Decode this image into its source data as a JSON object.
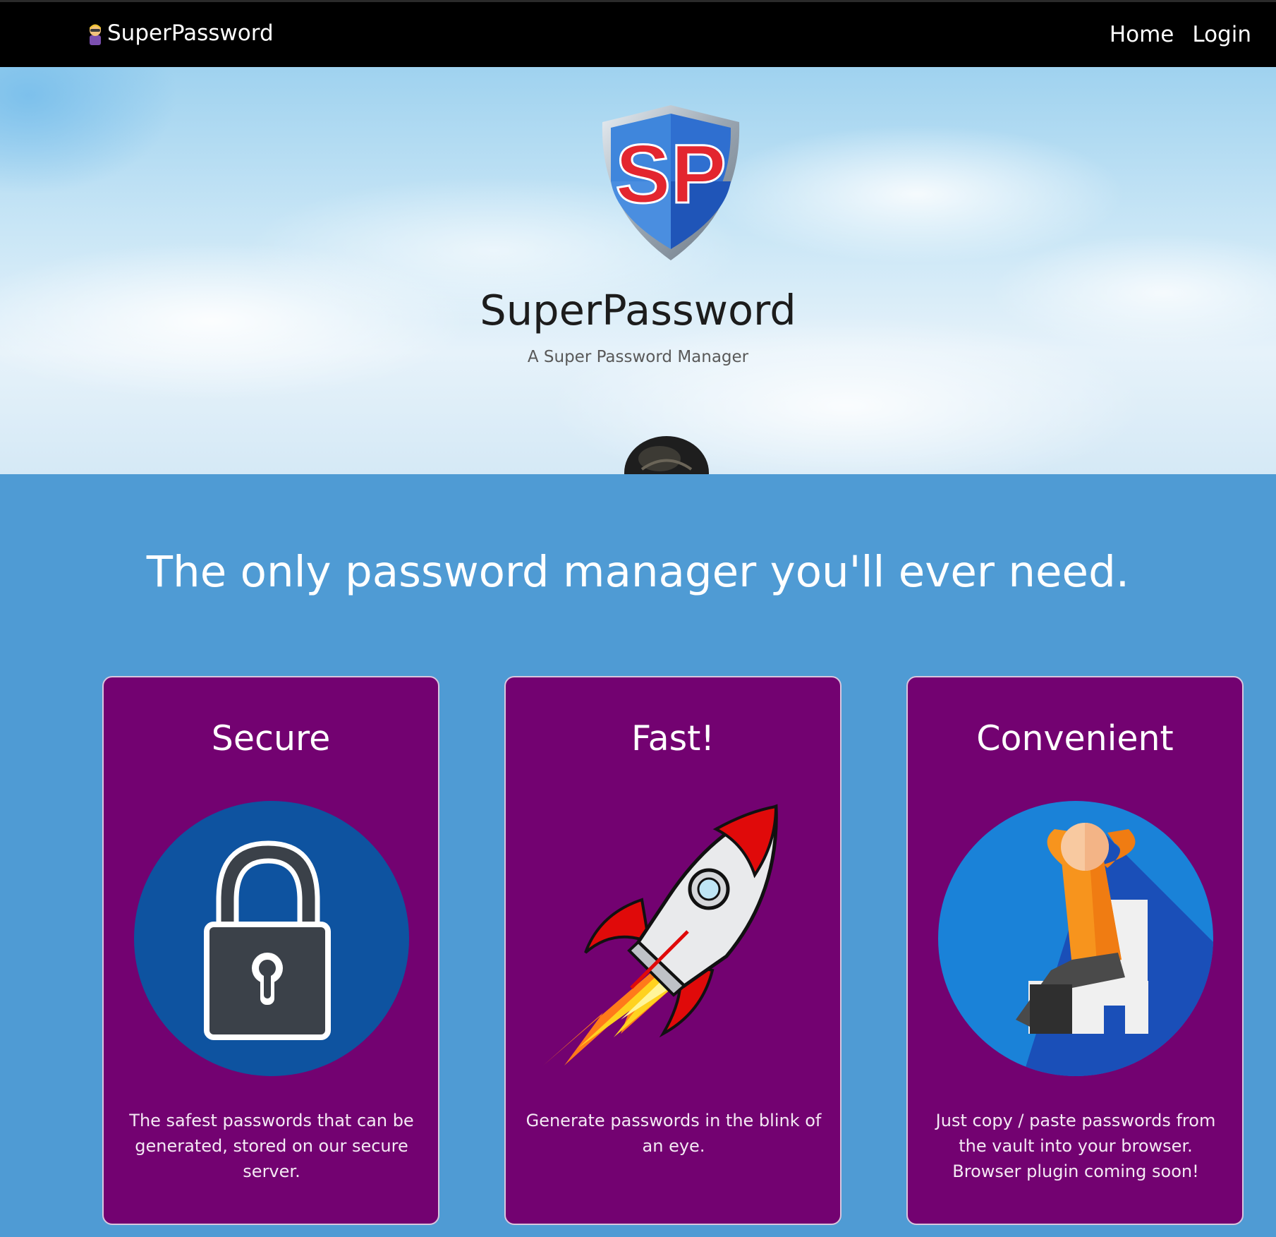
{
  "navbar": {
    "brand": "SuperPassword",
    "brand_icon": "superhero-icon",
    "links": [
      "Home",
      "Login"
    ]
  },
  "hero": {
    "logo_icon": "sp-shield-logo",
    "logo_text": "SP",
    "title": "SuperPassword",
    "subtitle": "A Super Password Manager"
  },
  "main": {
    "tagline": "The only password manager you'll ever need.",
    "cards": [
      {
        "title": "Secure",
        "icon": "padlock-icon",
        "text": "The safest passwords that can be generated, stored on our secure server."
      },
      {
        "title": "Fast!",
        "icon": "rocket-icon",
        "text": "Generate passwords in the blink of an eye."
      },
      {
        "title": "Convenient",
        "icon": "relaxing-person-icon",
        "text": "Just copy / paste passwords from the vault into your browser. Browser plugin coming soon!"
      }
    ]
  },
  "colors": {
    "navbar_bg": "#000000",
    "page_bg": "#4f9bd4",
    "card_bg": "#730271",
    "logo_red": "#e3262f",
    "logo_blue": "#2f6fd0"
  }
}
